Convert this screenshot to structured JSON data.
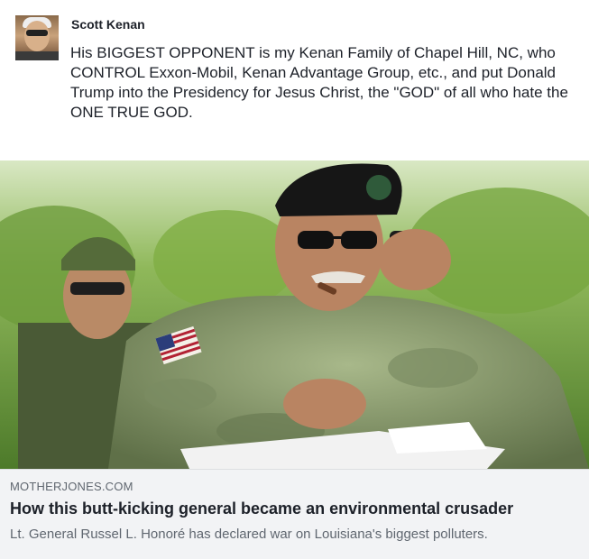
{
  "post": {
    "author": "Scott Kenan",
    "text": "His BIGGEST OPPONENT is my Kenan Family of Chapel Hill, NC, who CONTROL Exxon-Mobil, Kenan Advantage Group, etc., and put Donald Trump into the Presidency for Jesus Christ, the \"GOD\" of all who hate the ONE TRUE GOD."
  },
  "link": {
    "domain": "MOTHERJONES.COM",
    "title": "How this butt-kicking general became an environmental crusader",
    "description": "Lt. General Russel L. Honoré has declared war on Louisiana's biggest polluters."
  }
}
